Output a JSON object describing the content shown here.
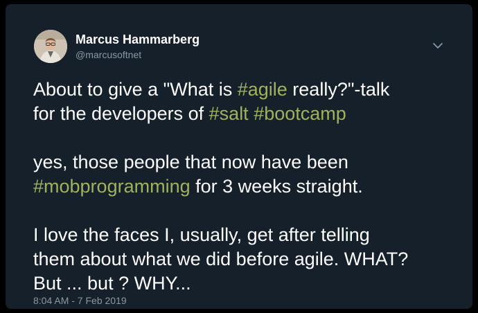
{
  "author": {
    "display_name": "Marcus Hammarberg",
    "handle": "@marcusoftnet",
    "avatar": "avatar-photo"
  },
  "menu": {
    "icon": "chevron-down-icon"
  },
  "tweet": {
    "line1": {
      "t1": "About to give a \"What is ",
      "h1": "#agile",
      "t2": " really?\"-talk"
    },
    "line2": {
      "t1": "for the developers of ",
      "h1": "#salt",
      "t2": " ",
      "h2": "#bootcamp"
    },
    "line3": {
      "t1": "yes, those people that now have been"
    },
    "line4": {
      "h1": "#mobprogramming",
      "t1": " for 3 weeks straight."
    },
    "line5": {
      "t1": "I love the faces I, usually, get after telling"
    },
    "line6": {
      "t1": "them about what we did before agile. WHAT?"
    },
    "line7": {
      "t1": "But ... but ? WHY..."
    }
  },
  "timestamp": "8:04 AM - 7 Feb 2019",
  "colors": {
    "background": "#15202b",
    "hashtag": "#a1b25d",
    "secondary_text": "#8899a6"
  }
}
